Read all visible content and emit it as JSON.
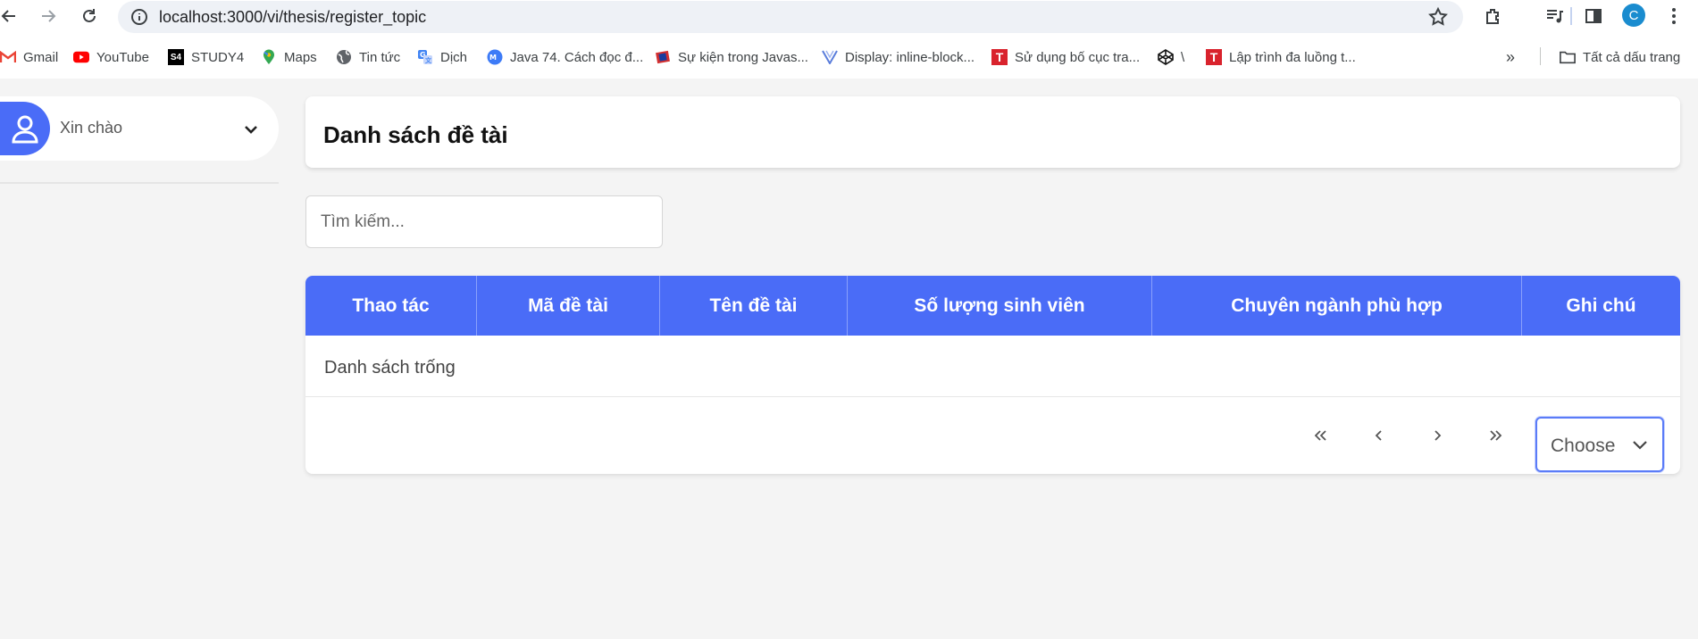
{
  "browser": {
    "url": "localhost:3000/vi/thesis/register_topic",
    "profile_initial": "C",
    "bookmarks": [
      {
        "label": "Gmail",
        "icon": "gmail-icon"
      },
      {
        "label": "YouTube",
        "icon": "youtube-icon"
      },
      {
        "label": "STUDY4",
        "icon": "study4-icon"
      },
      {
        "label": "Maps",
        "icon": "maps-icon"
      },
      {
        "label": "Tin tức",
        "icon": "globe-icon"
      },
      {
        "label": "Dịch",
        "icon": "translate-icon"
      },
      {
        "label": "Java 74. Cách đọc đ...",
        "icon": "java-icon"
      },
      {
        "label": "Sự kiện trong Javas...",
        "icon": "book-icon"
      },
      {
        "label": "Display: inline-block...",
        "icon": "vue-icon"
      },
      {
        "label": "Sử dụng bố cục tra...",
        "icon": "t-icon"
      },
      {
        "label": "\\",
        "icon": "codepen-icon"
      },
      {
        "label": "Lập trình đa luồng t...",
        "icon": "t-icon"
      }
    ],
    "all_bookmarks_label": "Tất cả dấu trang"
  },
  "sidebar": {
    "greeting": "Xin chào"
  },
  "main": {
    "title": "Danh sách đề tài",
    "search_placeholder": "Tìm kiếm...",
    "table": {
      "columns": [
        "Thao tác",
        "Mã đề tài",
        "Tên đề tài",
        "Số lượng sinh viên",
        "Chuyên ngành phù hợp",
        "Ghi chú"
      ],
      "empty_text": "Danh sách trống"
    },
    "pagination": {
      "first": "«",
      "prev": "‹",
      "next": "›",
      "last": "»",
      "page_size_value": "Choose"
    }
  },
  "colors": {
    "accent": "#4a6cf7",
    "background": "#f4f4f4"
  }
}
